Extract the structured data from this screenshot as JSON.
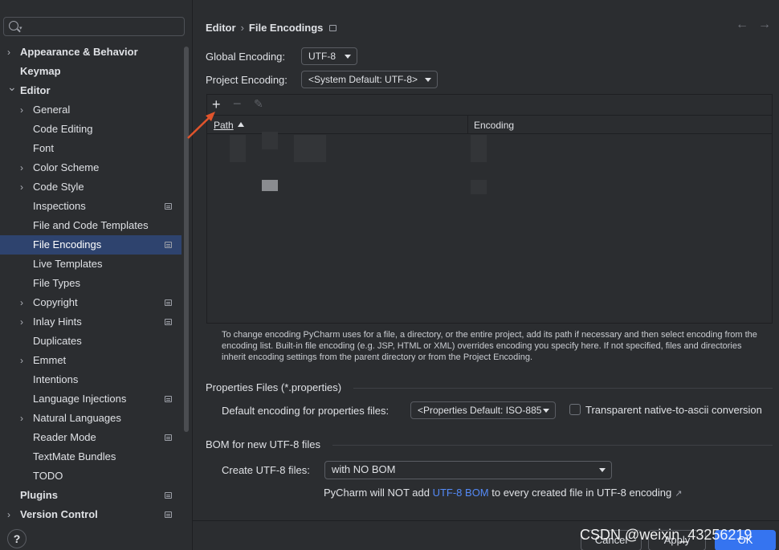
{
  "search": {
    "placeholder": ""
  },
  "sidebar": {
    "items": [
      {
        "label": "Appearance & Behavior",
        "level": 0,
        "chevron": true,
        "bold": true,
        "badge": false
      },
      {
        "label": "Keymap",
        "level": 0,
        "chevron": false,
        "bold": true,
        "badge": false
      },
      {
        "label": "Editor",
        "level": 0,
        "chevron": true,
        "expanded": true,
        "bold": true,
        "badge": false
      },
      {
        "label": "General",
        "level": 1,
        "chevron": true,
        "badge": false
      },
      {
        "label": "Code Editing",
        "level": 1,
        "chevron": false,
        "badge": false
      },
      {
        "label": "Font",
        "level": 1,
        "chevron": false,
        "badge": false
      },
      {
        "label": "Color Scheme",
        "level": 1,
        "chevron": true,
        "badge": false
      },
      {
        "label": "Code Style",
        "level": 1,
        "chevron": true,
        "badge": false
      },
      {
        "label": "Inspections",
        "level": 1,
        "chevron": false,
        "badge": true
      },
      {
        "label": "File and Code Templates",
        "level": 1,
        "chevron": false,
        "badge": false
      },
      {
        "label": "File Encodings",
        "level": 1,
        "chevron": false,
        "badge": true,
        "selected": true
      },
      {
        "label": "Live Templates",
        "level": 1,
        "chevron": false,
        "badge": false
      },
      {
        "label": "File Types",
        "level": 1,
        "chevron": false,
        "badge": false
      },
      {
        "label": "Copyright",
        "level": 1,
        "chevron": true,
        "badge": true
      },
      {
        "label": "Inlay Hints",
        "level": 1,
        "chevron": true,
        "badge": true
      },
      {
        "label": "Duplicates",
        "level": 1,
        "chevron": false,
        "badge": false
      },
      {
        "label": "Emmet",
        "level": 1,
        "chevron": true,
        "badge": false
      },
      {
        "label": "Intentions",
        "level": 1,
        "chevron": false,
        "badge": false
      },
      {
        "label": "Language Injections",
        "level": 1,
        "chevron": false,
        "badge": true
      },
      {
        "label": "Natural Languages",
        "level": 1,
        "chevron": true,
        "badge": false
      },
      {
        "label": "Reader Mode",
        "level": 1,
        "chevron": false,
        "badge": true
      },
      {
        "label": "TextMate Bundles",
        "level": 1,
        "chevron": false,
        "badge": false
      },
      {
        "label": "TODO",
        "level": 1,
        "chevron": false,
        "badge": false
      },
      {
        "label": "Plugins",
        "level": 0,
        "chevron": false,
        "bold": true,
        "badge": true
      },
      {
        "label": "Version Control",
        "level": 0,
        "chevron": true,
        "bold": true,
        "badge": true
      }
    ],
    "help_label": "?"
  },
  "breadcrumb": {
    "parent": "Editor",
    "separator": "›",
    "current": "File Encodings"
  },
  "nav": {
    "back": "←",
    "forward": "→"
  },
  "global_encoding": {
    "label": "Global Encoding:",
    "value": "UTF-8"
  },
  "project_encoding": {
    "label": "Project Encoding:",
    "value": "<System Default: UTF-8>"
  },
  "table": {
    "columns": {
      "path": "Path",
      "encoding": "Encoding"
    },
    "add_icon": "+",
    "remove_icon": "−",
    "edit_icon": "✎"
  },
  "help_text": "To change encoding PyCharm uses for a file, a directory, or the entire project, add its path if necessary and then select encoding from the encoding list. Built-in file encoding (e.g. JSP, HTML or XML) overrides encoding you specify here. If not specified, files and directories inherit encoding settings from the parent directory or from the Project Encoding.",
  "properties": {
    "section_title": "Properties Files (*.properties)",
    "default_label": "Default encoding for properties files:",
    "default_value": "<Properties Default: ISO-885",
    "transparent_label": "Transparent native-to-ascii conversion",
    "transparent_checked": false
  },
  "bom": {
    "section_title": "BOM for new UTF-8 files",
    "create_label": "Create UTF-8 files:",
    "create_value": "with NO BOM",
    "note_prefix": "PyCharm will NOT add ",
    "note_link": "UTF-8 BOM",
    "note_suffix": " to every created file in UTF-8 encoding",
    "note_ext_icon": "↗"
  },
  "buttons": {
    "cancel": "Cancel",
    "apply": "Apply",
    "ok": "OK"
  },
  "watermark": "CSDN @weixin_43256219",
  "colors": {
    "selection": "#2e436e",
    "link": "#548af7",
    "primary": "#3574f0",
    "annotation_arrow": "#e0542c"
  }
}
